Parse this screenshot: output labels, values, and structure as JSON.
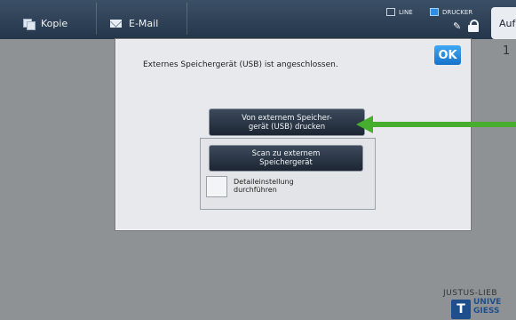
{
  "topbar": {
    "tab_kopie": "Kopie",
    "tab_email": "E-Mail",
    "line_label": "LINE",
    "drucker_label": "DRUCKER",
    "auf_button": "Auf"
  },
  "side_number": "1",
  "dialog": {
    "message": "Externes Speichergerät (USB) ist angeschlossen.",
    "ok_label": "OK",
    "print_button": "Von externem Speicher-\ngerät (USB) drucken",
    "scan_button": "Scan zu externem\nSpeichergerät",
    "detail_label": "Detaileinstellung\ndurchführen",
    "detail_checked": false
  },
  "logo": {
    "line1": "JUSTUS-LIEB",
    "line2": "UNIVE",
    "line3": "GIESS",
    "badge": "T"
  },
  "colors": {
    "accent_blue": "#1672c9",
    "arrow_green": "#47ad2e",
    "button_dark": "#1c2633"
  }
}
